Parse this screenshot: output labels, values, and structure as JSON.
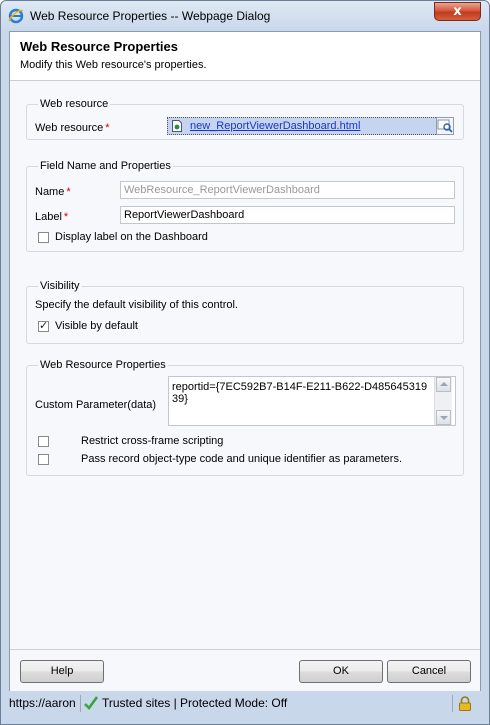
{
  "window": {
    "title": "Web Resource Properties -- Webpage Dialog",
    "close_label": "x"
  },
  "header": {
    "title": "Web Resource Properties",
    "subtitle": "Modify this Web resource's properties."
  },
  "web_resource_section": {
    "legend": "Web resource",
    "field_label": "Web resource",
    "required_mark": "*",
    "value": "new_ReportViewerDashboard.html"
  },
  "field_section": {
    "legend": "Field Name and Properties",
    "name_label": "Name",
    "name_value": "WebResource_ReportViewerDashboard",
    "label_label": "Label",
    "label_value": "ReportViewerDashboard",
    "display_label_checkbox": "Display label on the Dashboard",
    "display_label_checked": false,
    "required_mark": "*"
  },
  "visibility_section": {
    "legend": "Visibility",
    "description": "Specify the default visibility of this control.",
    "visible_checkbox": "Visible by default",
    "visible_checked": true
  },
  "properties_section": {
    "legend": "Web Resource Properties",
    "custom_param_label": "Custom Parameter(data)",
    "custom_param_value": "reportid={7EC592B7-B14F-E211-B622-D48564531939}",
    "restrict_label": "Restrict cross-frame scripting",
    "restrict_checked": false,
    "pass_record_label": "Pass record object-type code and unique identifier as parameters.",
    "pass_record_checked": false
  },
  "footer": {
    "help_label": "Help",
    "ok_label": "OK",
    "cancel_label": "Cancel"
  },
  "statusbar": {
    "url": "https://aaron",
    "zone": "Trusted sites | Protected Mode: Off"
  },
  "icons": {
    "ie": "ie-icon",
    "document": "document-icon",
    "lookup": "lookup-icon",
    "trusted": "checkmark-icon",
    "lock": "lock-icon"
  },
  "colors": {
    "link": "#1a36c8",
    "required": "#d00000",
    "lookup_selected": "#c5d4ef",
    "close_button": "#c23b1d"
  }
}
